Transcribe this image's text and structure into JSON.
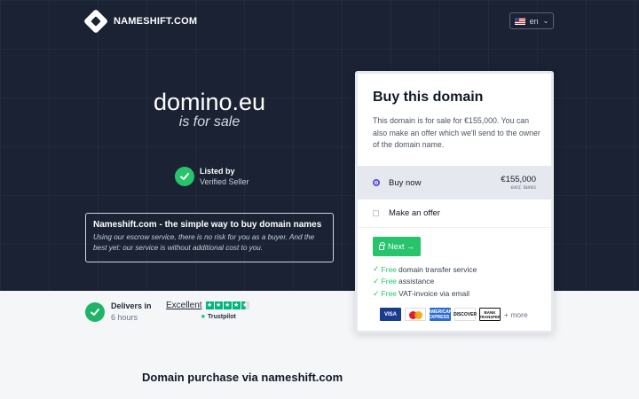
{
  "header": {
    "logo_text": "NAMESHIFT.COM",
    "language": "en"
  },
  "hero": {
    "domain": "domino.eu",
    "for_sale": "is for sale",
    "listed_title": "Listed by",
    "listed_sub": "Verified Seller",
    "info_title": "Nameshift.com - the simple way to buy domain names",
    "info_desc": "Using our escrow service, there is no risk for you as a buyer. And the best yet: our service is without additional cost to you."
  },
  "delivery": {
    "title": "Delivers in",
    "time": "6 hours"
  },
  "trustpilot": {
    "rating_label": "Excellent",
    "brand": "Trustpilot",
    "stars": 4.5
  },
  "section": {
    "title": "Domain purchase via nameshift.com"
  },
  "card": {
    "title": "Buy this domain",
    "description": "This domain is for sale for €155,000. You can also make an offer which we'll send to the owner of the domain name.",
    "buy_now_label": "Buy now",
    "price": "€155,000",
    "price_note": "excl. taxes",
    "offer_label": "Make an offer",
    "next_label": "Next →",
    "features": [
      {
        "free": "Free",
        "text": "domain transfer service"
      },
      {
        "free": "Free",
        "text": "assistance"
      },
      {
        "free": "Free",
        "text": "VAT-invoice via email"
      }
    ],
    "payments": [
      "VISA",
      "AMERICAN EXPRESS",
      "DISCOVER",
      "BANK TRANSFER"
    ],
    "more_label": "+ more"
  },
  "colors": {
    "hero_bg": "#1a2233",
    "accent_green": "#27c46b",
    "radio_purple": "#5b4fd6"
  }
}
